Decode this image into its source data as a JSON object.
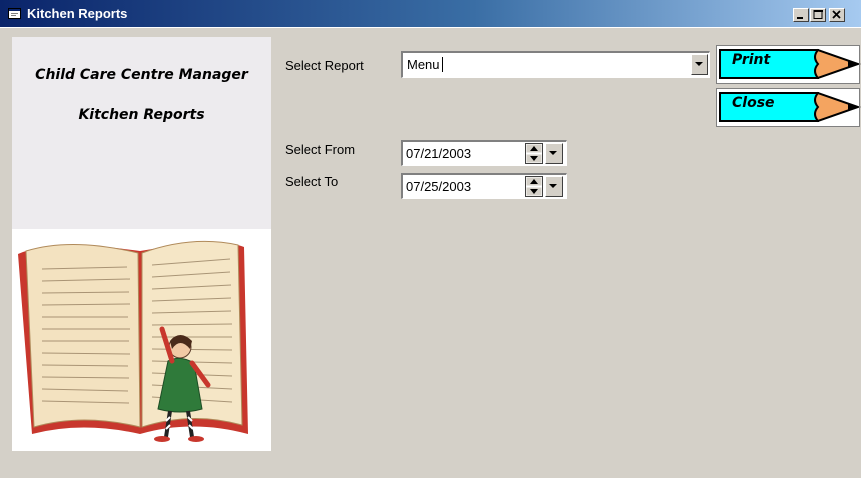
{
  "window": {
    "title": "Kitchen Reports",
    "icon": "app-window-icon"
  },
  "caption_buttons": {
    "minimize": "minimize-icon",
    "maximize": "maximize-icon",
    "close": "close-icon"
  },
  "left_panel": {
    "app_name": "Child Care Centre Manager",
    "subtitle": "Kitchen Reports",
    "illustration": "open-book-with-child-illustration"
  },
  "form": {
    "report_label": "Select Report",
    "report_value": "Menu",
    "from_label": "Select From",
    "from_value": "07/21/2003",
    "to_label": "Select To",
    "to_value": "07/25/2003"
  },
  "actions": {
    "print_label": "Print",
    "close_label": "Close"
  },
  "colors": {
    "button_fill": "#00ffff",
    "pencil_tip": "#f4a460",
    "title_gradient_start": "#0a246a",
    "title_gradient_end": "#a6caf0"
  }
}
